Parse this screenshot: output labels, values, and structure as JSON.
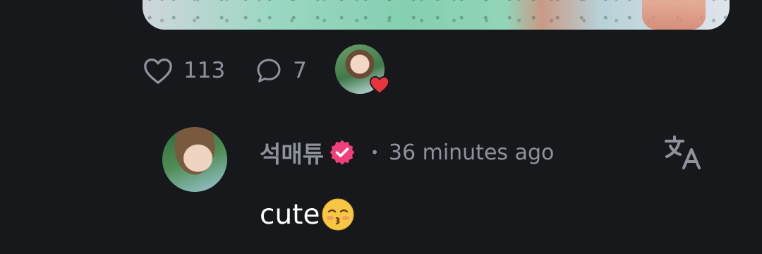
{
  "post": {
    "like_count": "113",
    "comment_count": "7"
  },
  "comment": {
    "username": "석매튜",
    "separator": "•",
    "timestamp": "36 minutes ago",
    "text": "cute",
    "emoji": "kissing-face-with-closed-eyes"
  },
  "icons": {
    "like": "heart-outline-icon",
    "comment": "speech-bubble-icon",
    "verified": "verified-badge-icon",
    "translate": "translate-icon",
    "reaction": "red-heart-icon"
  },
  "colors": {
    "background": "#16181c",
    "muted_text": "#8e929b",
    "comment_text": "#ffffff",
    "verified_badge": "#f23f7a",
    "heart_reaction": "#e8343c"
  }
}
